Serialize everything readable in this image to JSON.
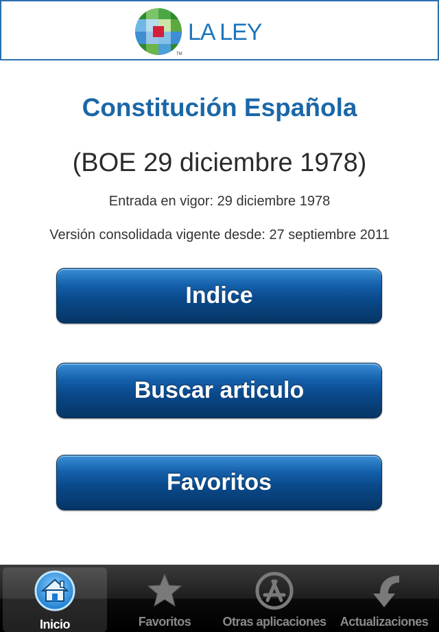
{
  "header": {
    "brand": "LA LEY",
    "logo_icon": "la-ley-logo-icon"
  },
  "main": {
    "title": "Constitución Española",
    "subtitle": "(BOE 29 diciembre 1978)",
    "entrada": "Entrada en vigor: 29 diciembre 1978",
    "version": "Versión consolidada vigente desde: 27 septiembre 2011"
  },
  "buttons": {
    "indice": "Indice",
    "buscar": "Buscar articulo",
    "favoritos": "Favoritos"
  },
  "tabbar": {
    "tabs": [
      {
        "label": "Inicio",
        "icon": "home-icon",
        "active": true
      },
      {
        "label": "Favoritos",
        "icon": "star-icon",
        "active": false
      },
      {
        "label": "Otras aplicaciones",
        "icon": "app-store-icon",
        "active": false
      },
      {
        "label": "Actualizaciones",
        "icon": "update-arrow-icon",
        "active": false
      }
    ]
  },
  "colors": {
    "brand_blue": "#1d75bc",
    "title_blue": "#1a67a8",
    "button_blue": "#0a4a8c"
  }
}
